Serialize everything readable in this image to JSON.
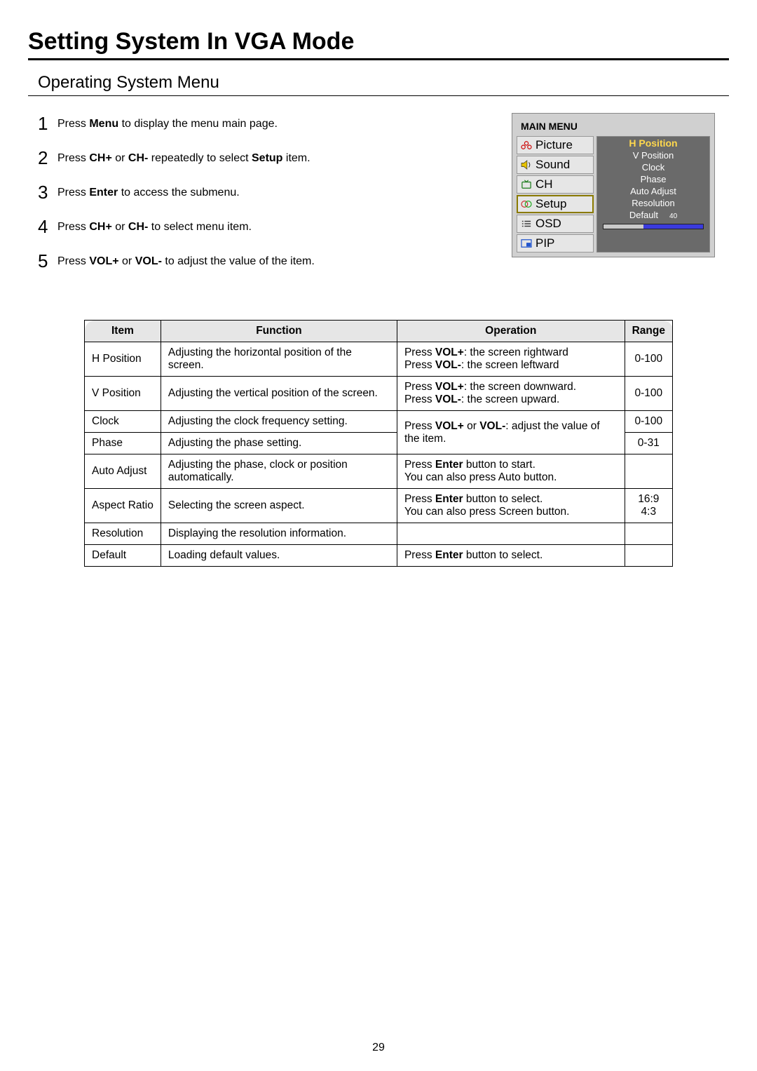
{
  "page": {
    "title": "Setting System In VGA Mode",
    "section": "Operating System Menu",
    "number": "29"
  },
  "steps": [
    {
      "n": "1",
      "pre": "Press ",
      "bold1": "Menu",
      "post": " to display the menu main page."
    },
    {
      "n": "2",
      "pre": "Press ",
      "bold1": "CH+",
      "mid1": " or ",
      "bold2": "CH-",
      "mid2": " repeatedly to select ",
      "bold3": "Setup",
      "post": " item."
    },
    {
      "n": "3",
      "pre": "Press ",
      "bold1": "Enter",
      "post": " to access the submenu."
    },
    {
      "n": "4",
      "pre": "Press ",
      "bold1": "CH+",
      "mid1": " or ",
      "bold2": "CH-",
      "post": " to select menu item."
    },
    {
      "n": "5",
      "pre": "Press ",
      "bold1": "VOL+",
      "mid1": " or ",
      "bold2": "VOL-",
      "post": " to adjust the value of the item."
    }
  ],
  "osd": {
    "title": "MAIN MENU",
    "left": [
      "Picture",
      "Sound",
      "CH",
      "Setup",
      "OSD",
      "PIP"
    ],
    "right": [
      "H Position",
      "V Position",
      "Clock",
      "Phase",
      "Auto Adjust",
      "Resolution"
    ],
    "default_label": "Default",
    "default_value": "40",
    "bar_percent": 40
  },
  "table": {
    "headers": {
      "item": "Item",
      "function": "Function",
      "operation": "Operation",
      "range": "Range"
    },
    "rows": [
      {
        "item": "H Position",
        "function": "Adjusting the horizontal position of the screen.",
        "op_l1a": "Press ",
        "op_l1b": "VOL+",
        "op_l1c": ": the screen rightward",
        "op_l2a": "Press ",
        "op_l2b": "VOL-",
        "op_l2c": ": the screen leftward",
        "range": "0-100"
      },
      {
        "item": "V Position",
        "function": "Adjusting the vertical position of the screen.",
        "op_l1a": "Press ",
        "op_l1b": "VOL+",
        "op_l1c": ": the screen downward.",
        "op_l2a": "Press ",
        "op_l2b": "VOL-",
        "op_l2c": ": the screen upward.",
        "range": "0-100"
      },
      {
        "item": "Clock",
        "function": "Adjusting the clock frequency setting.",
        "range": "0-100"
      },
      {
        "item": "Phase",
        "function": "Adjusting the phase setting.",
        "range": "0-31"
      },
      {
        "item": "Auto Adjust",
        "function": "Adjusting the phase, clock or position automatically.",
        "op_l1a": "Press ",
        "op_l1b": "Enter",
        "op_l1c": " button to start.",
        "op_l2": "You can also press Auto button.",
        "range": ""
      },
      {
        "item": "Aspect Ratio",
        "function": "Selecting the screen aspect.",
        "op_l1a": "Press ",
        "op_l1b": "Enter",
        "op_l1c": " button to select.",
        "op_l2": "You can also press Screen button.",
        "range": "16:9\n4:3"
      },
      {
        "item": "Resolution",
        "function": "Displaying the resolution information.",
        "op": "",
        "range": ""
      },
      {
        "item": "Default",
        "function": "Loading default values.",
        "op_l1a": "Press ",
        "op_l1b": "Enter",
        "op_l1c": " button to select.",
        "range": ""
      }
    ],
    "shared_op": {
      "a": "Press ",
      "b1": "VOL+",
      "mid": " or ",
      "b2": "VOL-",
      "c": ": adjust the value of the item."
    }
  }
}
